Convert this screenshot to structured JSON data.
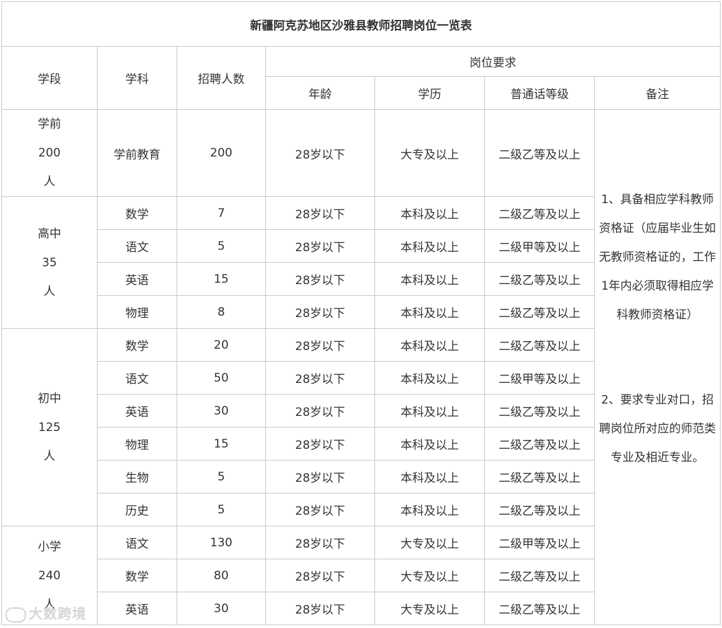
{
  "title": "新疆阿克苏地区沙雅县教师招聘岗位一览表",
  "headers": {
    "stage": "学段",
    "subject": "学科",
    "count": "招聘人数",
    "requirements": "岗位要求",
    "age": "年龄",
    "education": "学历",
    "mandarin": "普通话等级",
    "remarks": "备注"
  },
  "groups": [
    {
      "name": "学前",
      "total": "200",
      "unit": "人",
      "rows": [
        {
          "subject": "学前教育",
          "count": "200",
          "age": "28岁以下",
          "edu": "大专及以上",
          "mandarin": "二级乙等及以上"
        }
      ]
    },
    {
      "name": "高中",
      "total": "35",
      "unit": "人",
      "rows": [
        {
          "subject": "数学",
          "count": "7",
          "age": "28岁以下",
          "edu": "本科及以上",
          "mandarin": "二级乙等及以上"
        },
        {
          "subject": "语文",
          "count": "5",
          "age": "28岁以下",
          "edu": "本科及以上",
          "mandarin": "二级甲等及以上"
        },
        {
          "subject": "英语",
          "count": "15",
          "age": "28岁以下",
          "edu": "本科及以上",
          "mandarin": "二级乙等及以上"
        },
        {
          "subject": "物理",
          "count": "8",
          "age": "28岁以下",
          "edu": "本科及以上",
          "mandarin": "二级乙等及以上"
        }
      ]
    },
    {
      "name": "初中",
      "total": "125",
      "unit": "人",
      "rows": [
        {
          "subject": "数学",
          "count": "20",
          "age": "28岁以下",
          "edu": "本科及以上",
          "mandarin": "二级乙等及以上"
        },
        {
          "subject": "语文",
          "count": "50",
          "age": "28岁以下",
          "edu": "本科及以上",
          "mandarin": "二级甲等及以上"
        },
        {
          "subject": "英语",
          "count": "30",
          "age": "28岁以下",
          "edu": "本科及以上",
          "mandarin": "二级乙等及以上"
        },
        {
          "subject": "物理",
          "count": "15",
          "age": "28岁以下",
          "edu": "本科及以上",
          "mandarin": "二级乙等及以上"
        },
        {
          "subject": "生物",
          "count": "5",
          "age": "28岁以下",
          "edu": "本科及以上",
          "mandarin": "二级乙等及以上"
        },
        {
          "subject": "历史",
          "count": "5",
          "age": "28岁以下",
          "edu": "本科及以上",
          "mandarin": "二级乙等及以上"
        }
      ]
    },
    {
      "name": "小学",
      "total": "240",
      "unit": "人",
      "rows": [
        {
          "subject": "语文",
          "count": "130",
          "age": "28岁以下",
          "edu": "大专及以上",
          "mandarin": "二级甲等及以上"
        },
        {
          "subject": "数学",
          "count": "80",
          "age": "28岁以下",
          "edu": "大专及以上",
          "mandarin": "二级乙等及以上"
        },
        {
          "subject": "英语",
          "count": "30",
          "age": "28岁以下",
          "edu": "大专及以上",
          "mandarin": "二级乙等及以上"
        }
      ]
    }
  ],
  "remarks": {
    "note1_lines": [
      "1、具备相应学科教师",
      "资格证（应届毕业生如",
      "无教师资格证的，工作",
      "1年内必须取得相应学",
      "科教师资格证）"
    ],
    "note2_lines": [
      "2、要求专业对口，招",
      "聘岗位所对应的师范类",
      "专业及相近专业。"
    ]
  },
  "watermark": "大数跨境"
}
